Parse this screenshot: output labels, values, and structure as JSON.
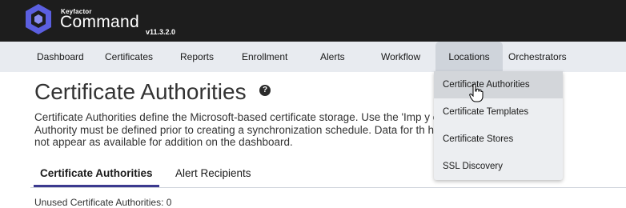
{
  "header": {
    "brand_small": "Keyfactor",
    "brand_name": "Command",
    "version": "v11.3.2.0",
    "logo_icon": "keyfactor-hexagon-logo",
    "colors": {
      "background": "#1d1d1d",
      "logo": "#5b5fe0"
    }
  },
  "nav": {
    "items": [
      {
        "label": "Dashboard"
      },
      {
        "label": "Certificates"
      },
      {
        "label": "Reports"
      },
      {
        "label": "Enrollment"
      },
      {
        "label": "Alerts"
      },
      {
        "label": "Workflow"
      },
      {
        "label": "Locations"
      },
      {
        "label": "Orchestrators"
      }
    ],
    "active": "Locations"
  },
  "dropdown": {
    "items": [
      {
        "label": "Certificate Authorities"
      },
      {
        "label": "Certificate Templates"
      },
      {
        "label": "Certificate Stores"
      },
      {
        "label": "SSL Discovery"
      }
    ],
    "hovered": "Certificate Authorities"
  },
  "page": {
    "title": "Certificate Authorities",
    "help_icon": "question-circle-icon",
    "description_lines": [
      "Certificate Authorities define the Microsoft-based certificate storage. Use the 'Imp                                   y obtain Micro",
      "Authority must be defined prior to creating a synchronization schedule. Data for th                                   hboard is gen",
      "not appear as available for addition on the dashboard."
    ],
    "subtabs": [
      {
        "label": "Certificate Authorities"
      },
      {
        "label": "Alert Recipients"
      }
    ],
    "selected_subtab": "Certificate Authorities",
    "cut_off_text": "Unused Certificate Authorities: 0"
  },
  "colors": {
    "nav_background": "#e8ebf0",
    "active_tab": "#cfd4db",
    "subtab_underline": "#3c3a8f"
  }
}
